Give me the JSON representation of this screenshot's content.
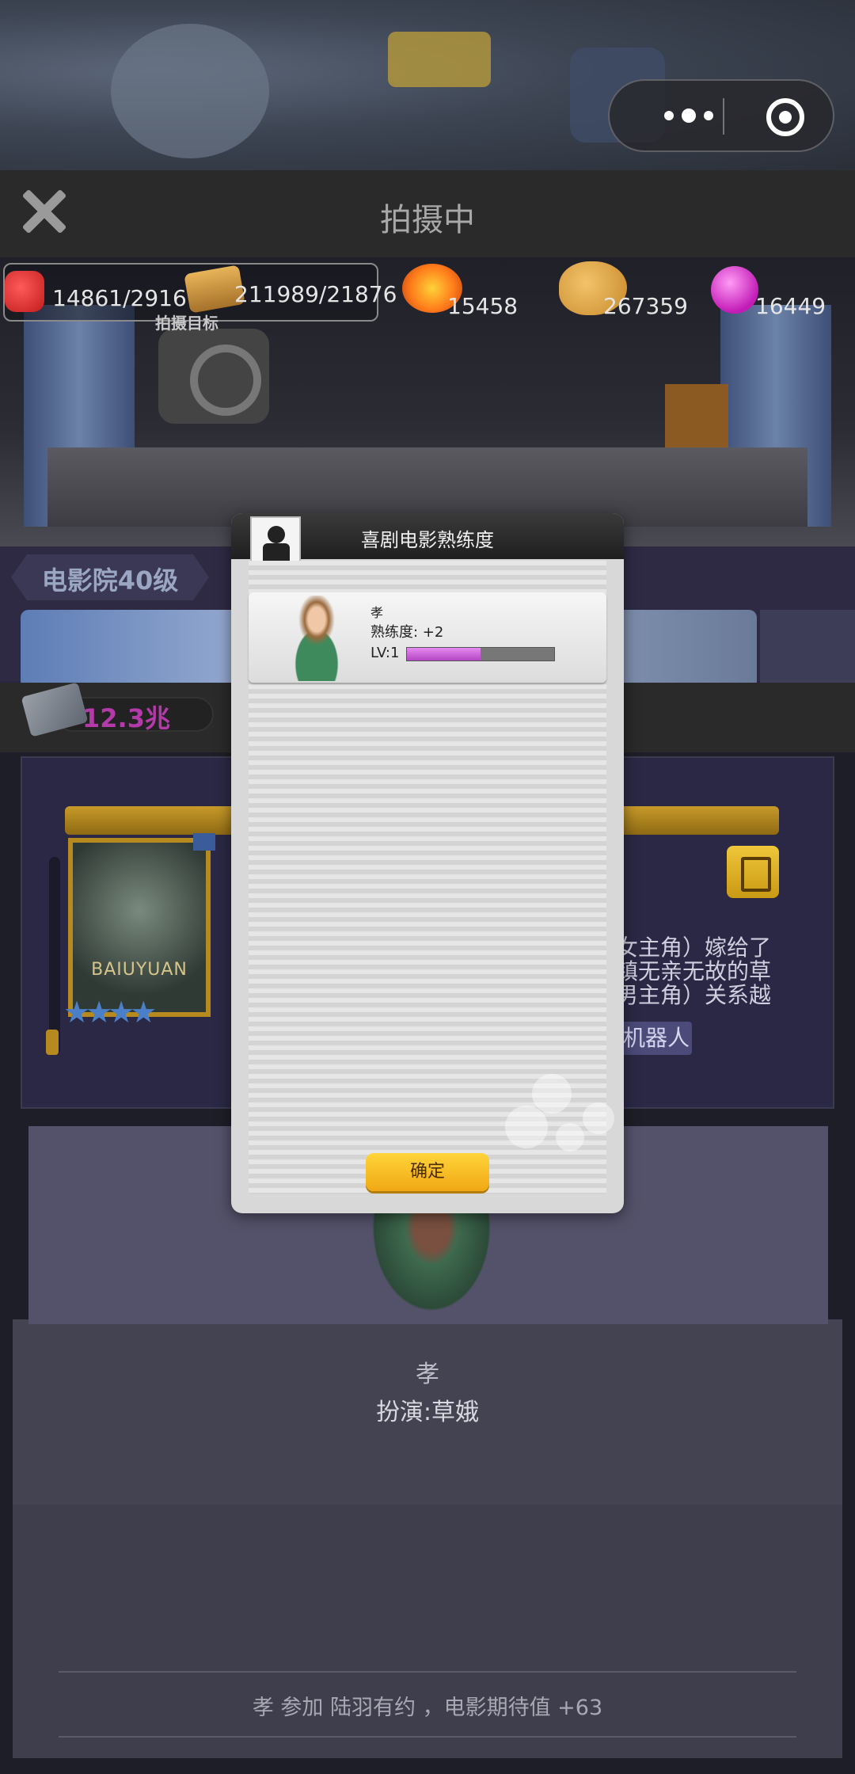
{
  "header": {
    "title": "拍摄中"
  },
  "resources": {
    "items": [
      {
        "icon": "comedy-mask-icon",
        "value": "14861/29167"
      },
      {
        "icon": "book-icon",
        "value": "211989/21876"
      },
      {
        "icon": "explosion-icon",
        "value": "15458"
      },
      {
        "icon": "palette-icon",
        "value": "267359"
      },
      {
        "icon": "gem-icon",
        "value": "16449"
      }
    ],
    "target_label": "拍摄目标"
  },
  "cinema": {
    "level": "电影院40级"
  },
  "money": {
    "value": "12.3兆"
  },
  "film": {
    "poster_title": "BAIUYUAN",
    "stars": "★★★★",
    "synopsis": "女主角）嫁给了\n镇无亲无故的草\n男主角）关系越",
    "role_tag": "机器人"
  },
  "actor": {
    "name": "孝",
    "role": "扮演:草娥"
  },
  "footer": {
    "message": "孝  参加 陆羽有约 ，电影期待值 +63"
  },
  "modal": {
    "title": "喜剧电影熟练度",
    "character_name": "孝",
    "proficiency": "熟练度: +2",
    "level_label": "LV:1",
    "level_progress": 0.5,
    "confirm_label": "确定"
  },
  "colors": {
    "accent_gold": "#f0c63a",
    "progress_purple": "#c84fd8",
    "money_purple": "#b33aa8"
  }
}
